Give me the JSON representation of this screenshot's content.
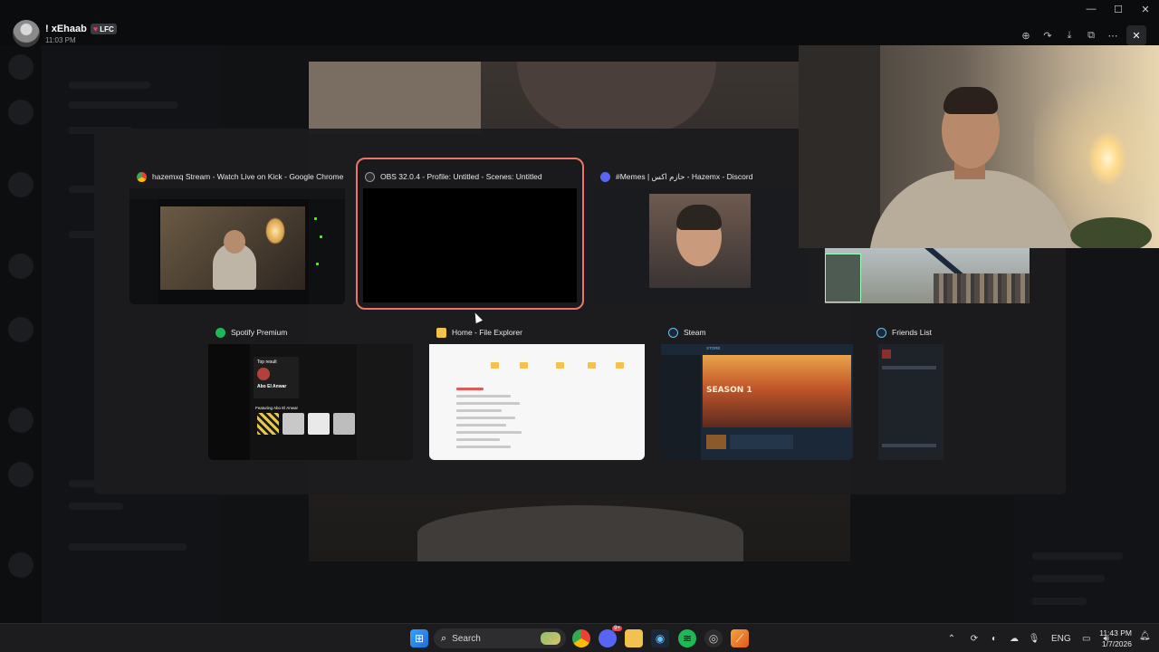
{
  "viewer": {
    "user_name": "! xEhaab",
    "user_tag": "LFC",
    "time": "11:03 PM",
    "tools": [
      "zoom-icon",
      "forward-icon",
      "download-icon",
      "open-external-icon",
      "more-icon",
      "close-icon"
    ]
  },
  "switcher": {
    "windows": [
      {
        "title": "hazemxq Stream - Watch Live on Kick - Google Chrome",
        "app": "chrome-icon",
        "accent": "#4285f4"
      },
      {
        "title": "OBS 32.0.4 - Profile: Untitled - Scenes: Untitled",
        "app": "obs-icon",
        "accent": "#888888",
        "selected": true
      },
      {
        "title": "#Memes | حازم اكس - Hazemx - Discord",
        "app": "discord-icon",
        "accent": "#5865f2"
      },
      {
        "title": "Spotify Premium",
        "app": "spotify-icon",
        "accent": "#1db954"
      },
      {
        "title": "Home - File Explorer",
        "app": "file-explorer-icon",
        "accent": "#f3c24e"
      },
      {
        "title": "Steam",
        "app": "steam-icon",
        "accent": "#66c0f4"
      },
      {
        "title": "Friends List",
        "app": "steam-friends-icon",
        "accent": "#66c0f4"
      }
    ]
  },
  "thumbs": {
    "spotify_artist": "Abo El Anwar",
    "spotify_section": "Top result",
    "spotify_featuring": "Featuring Abo El Anwar",
    "steam_hero": "SEASON 1",
    "steam_tab": "STORE"
  },
  "taskbar": {
    "search_placeholder": "Search",
    "discord_badge": "9+",
    "language": "ENG",
    "time": "11:43 PM",
    "date": "1/7/2026"
  }
}
